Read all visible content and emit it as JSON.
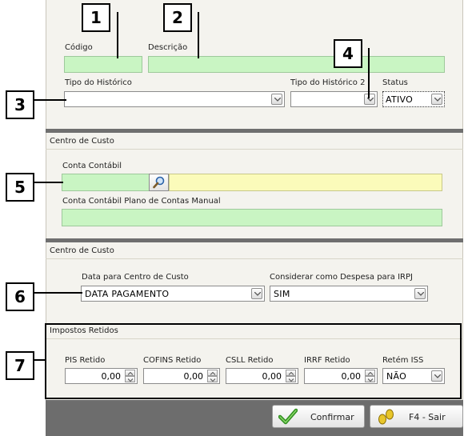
{
  "callouts": [
    "1",
    "2",
    "3",
    "4",
    "5",
    "6",
    "7"
  ],
  "header_form": {
    "codigo_label": "Código",
    "descricao_label": "Descrição",
    "tipo_historico_label": "Tipo do Histórico",
    "tipo_historico_value": "",
    "tipo_historico2_label": "Tipo do Histórico 2",
    "tipo_historico2_value": "",
    "status_label": "Status",
    "status_value": "ATIVO"
  },
  "section_cc1": {
    "title": "Centro de Custo",
    "conta_contabil_label": "Conta Contábil",
    "conta_contabil_plano_label": "Conta Contábil Plano de Contas Manual"
  },
  "section_cc2": {
    "title": "Centro de Custo",
    "data_label": "Data para Centro de Custo",
    "data_value": "DATA PAGAMENTO",
    "despesa_label": "Considerar como Despesa para IRPJ",
    "despesa_value": "SIM"
  },
  "section_impostos": {
    "title": "Impostos Retidos",
    "pis_label": "PIS Retido",
    "pis_value": "0,00",
    "cofins_label": "COFINS Retido",
    "cofins_value": "0,00",
    "csll_label": "CSLL Retido",
    "csll_value": "0,00",
    "irrf_label": "IRRF Retido",
    "irrf_value": "0,00",
    "iss_label": "Retém ISS",
    "iss_value": "NÃO"
  },
  "footer": {
    "confirm_label": "Confirmar",
    "exit_label": "F4 - Sair"
  },
  "colors": {
    "required_field": "#c9f5c3",
    "highlight_field": "#fbfbba",
    "separator": "#6f6f6f",
    "panel": "#f4f3ee"
  },
  "icons": [
    "search-icon",
    "checkmark-icon",
    "footprints-icon",
    "chevron-down-icon",
    "spin-up-icon",
    "spin-down-icon"
  ]
}
